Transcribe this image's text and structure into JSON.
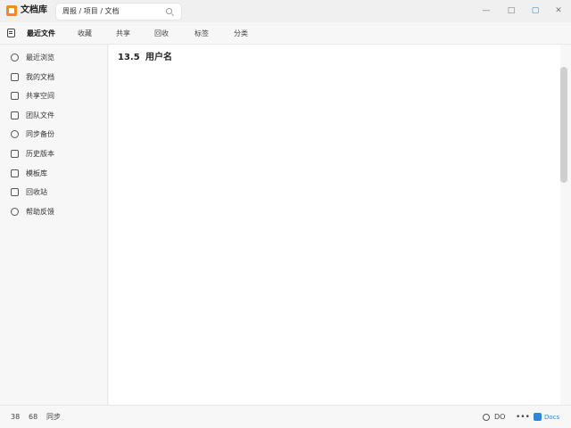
{
  "titlebar": {
    "app_name": "文档库",
    "search_value": "周报 / 项目 / 文档",
    "window_controls": [
      "—",
      "□",
      "▢",
      "✕"
    ]
  },
  "tabs": [
    {
      "label": "最近文件",
      "active": true
    },
    {
      "label": "收藏"
    },
    {
      "label": "共享"
    },
    {
      "label": "回收"
    },
    {
      "label": "标签"
    },
    {
      "label": "分类"
    }
  ],
  "sidebar": {
    "items": [
      {
        "label": "最近浏览",
        "icon": "clock-icon"
      },
      {
        "label": "我的文档",
        "icon": "document-icon"
      },
      {
        "label": "共享空间",
        "icon": "shared-icon"
      },
      {
        "label": "团队文件",
        "icon": "team-icon"
      },
      {
        "label": "同步备份",
        "icon": "sync-icon"
      },
      {
        "label": "历史版本",
        "icon": "history-icon"
      },
      {
        "label": "模板库",
        "icon": "template-icon"
      },
      {
        "label": "回收站",
        "icon": "trash-icon"
      },
      {
        "label": "帮助反馈",
        "icon": "help-icon"
      }
    ]
  },
  "main": {
    "number": "13.5",
    "text": "用户名"
  },
  "statusbar": {
    "left": [
      "38",
      "68",
      "同步"
    ],
    "right_text": "DO",
    "more": "•••",
    "brand": "Docs"
  },
  "colors": {
    "accent": "#f28a1c",
    "brand_blue": "#2f86d6"
  }
}
